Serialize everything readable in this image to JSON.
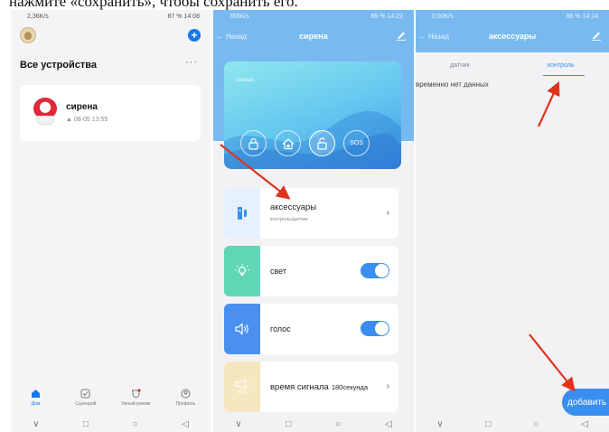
{
  "caption": "нажмите «сохранить», чтобы сохранить его.",
  "screen1": {
    "status_left": "2,36K/s",
    "status_right": "87 % 14:08",
    "section_title": "Все устройства",
    "more": "···",
    "device": {
      "name": "сирена",
      "time": "08-05 13:55"
    },
    "nav": [
      {
        "label": "Дом",
        "icon": "home-icon"
      },
      {
        "label": "Сценарий",
        "icon": "scenario-icon"
      },
      {
        "label": "Умный режим",
        "icon": "smart-mode-icon"
      },
      {
        "label": "Профиль",
        "icon": "profile-icon"
      }
    ],
    "sysbar": [
      "∨",
      "□",
      "○",
      "◁"
    ]
  },
  "screen2": {
    "status_left": "356K/s",
    "status_right": "85 % 14:22",
    "back": "Назад",
    "title": "сирена",
    "alarm_label": "сигнал",
    "buttons": [
      "lock",
      "home",
      "unlock",
      "SOS"
    ],
    "rows": {
      "accessories": {
        "label": "аксессуары",
        "sub": "контроль/датчик"
      },
      "light": {
        "label": "свет",
        "on": true
      },
      "voice": {
        "label": "голос",
        "on": true
      },
      "alarm_time": {
        "label": "время сигнала",
        "value": "180секунда",
        "icon_text": "HNS"
      }
    },
    "sysbar": [
      "∨",
      "□",
      "○",
      "◁"
    ]
  },
  "screen3": {
    "status_left": "0,00K/s",
    "status_right": "86 % 14:14",
    "back": "Назад",
    "title": "аксессуары",
    "tab_sensor": "датчик",
    "tab_control": "контроль",
    "empty_text": "временно нет данных",
    "fab": "добавить",
    "sysbar": [
      "∨",
      "□",
      "○",
      "◁"
    ]
  },
  "colors": {
    "accent": "#3a8ef0",
    "header": "#78b9f0",
    "arrow": "#e0321e"
  }
}
